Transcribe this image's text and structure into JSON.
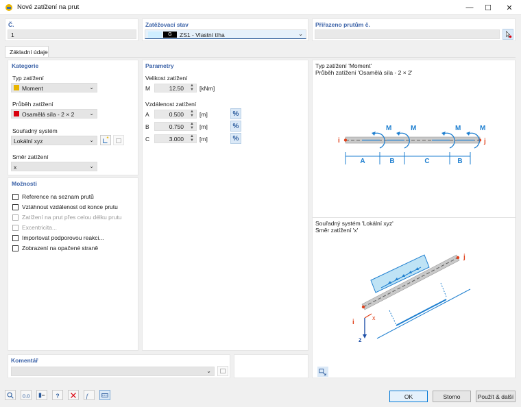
{
  "window": {
    "title": "Nové zatížení na prut",
    "minimize": "—",
    "maximize": "☐",
    "close": "✕"
  },
  "header": {
    "no_label": "Č.",
    "no_value": "1",
    "loadcase_label": "Zatěžovací stav",
    "loadcase_badge": "G",
    "loadcase_value": "ZS1 - Vlastní tíha",
    "assigned_label": "Přiřazeno prutům č.",
    "assigned_value": ""
  },
  "tabs": [
    {
      "label": "Základní údaje"
    }
  ],
  "category": {
    "title": "Kategorie",
    "load_type_label": "Typ zatížení",
    "load_type_value": "Moment",
    "load_type_color": "#e8b400",
    "distribution_label": "Průběh zatížení",
    "distribution_value": "Osamělá síla - 2 × 2",
    "distribution_color": "#d9000d",
    "coord_label": "Souřadný systém",
    "coord_value": "Lokální xyz",
    "direction_label": "Směr zatížení",
    "direction_value": "x"
  },
  "options": {
    "title": "Možnosti",
    "items": [
      {
        "label": "Reference na seznam prutů",
        "checked": false,
        "disabled": false
      },
      {
        "label": "Vztáhnout vzdálenost od konce prutu",
        "checked": false,
        "disabled": false
      },
      {
        "label": "Zatížení na prut přes celou délku prutu",
        "checked": false,
        "disabled": true
      },
      {
        "label": "Excentricita...",
        "checked": false,
        "disabled": true
      },
      {
        "label": "Importovat podporovou reakci...",
        "checked": false,
        "disabled": false
      },
      {
        "label": "Zobrazení na opačené straně",
        "checked": false,
        "disabled": false
      }
    ]
  },
  "parameters": {
    "title": "Parametry",
    "magnitude_label": "Velikost zatížení",
    "magnitude": {
      "symbol": "M",
      "value": "12.50",
      "unit": "[kNm]"
    },
    "distance_label": "Vzdálenost zatížení",
    "distances": [
      {
        "symbol": "A",
        "value": "0.500",
        "unit": "[m]"
      },
      {
        "symbol": "B",
        "value": "0.750",
        "unit": "[m]"
      },
      {
        "symbol": "C",
        "value": "3.000",
        "unit": "[m]"
      }
    ],
    "percent_symbol": "%"
  },
  "preview_top": {
    "line1": "Typ zatížení 'Moment'",
    "line2": "Průběh zatížení 'Osamělá síla - 2 × 2'",
    "moment_label": "M",
    "node_i": "i",
    "node_j": "j",
    "dims": [
      "A",
      "B",
      "C",
      "B"
    ]
  },
  "preview_bottom": {
    "line1": "Souřadný systém 'Lokální xyz'",
    "line2": "Směr zatížení 'x'",
    "axis_x": "x",
    "axis_z": "z",
    "node_i": "i",
    "node_j": "j"
  },
  "comment": {
    "title": "Komentář",
    "value": ""
  },
  "buttons": {
    "ok": "OK",
    "cancel": "Storno",
    "apply_next": "Použít & další"
  },
  "colors": {
    "accent": "#3c63a8",
    "arrow": "#1e7fd0",
    "node": "#e0401a"
  }
}
